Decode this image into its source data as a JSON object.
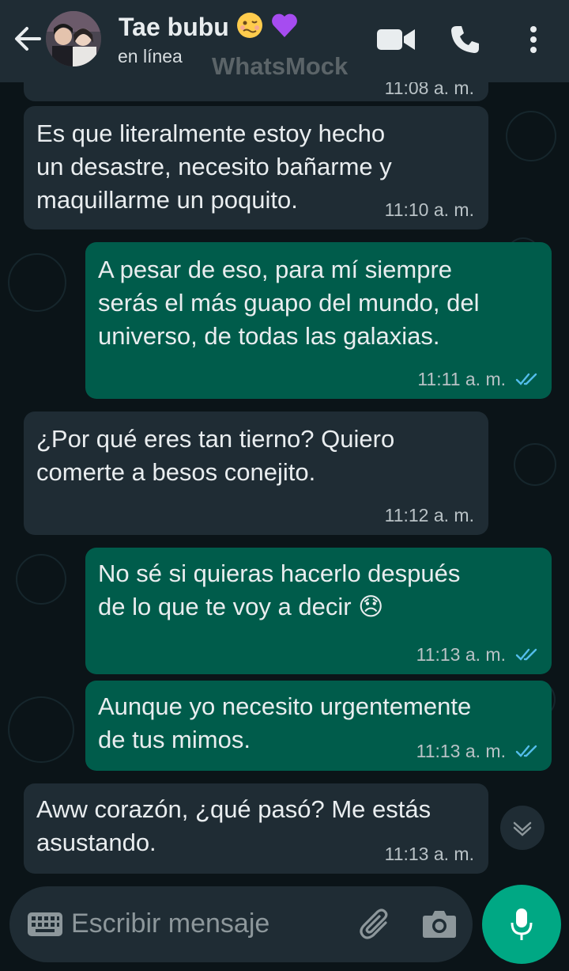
{
  "header": {
    "contact_name": "Tae bubu",
    "status": "en línea",
    "watermark": "WhatsMock",
    "emoji_1": "🥴",
    "emoji_2": "💜"
  },
  "messages": [
    {
      "direction": "in",
      "text": "11:08 a. m.",
      "partial": true
    },
    {
      "direction": "in",
      "text": "Es que literalmente estoy hecho\nun desastre, necesito bañarme y\nmaquillarme un poquito.",
      "time": "11:10 a. m."
    },
    {
      "direction": "out",
      "text": "A pesar de eso, para mí siempre\nserás el más guapo del mundo, del\nuniverso, de todas las galaxias.",
      "time": "11:11 a. m."
    },
    {
      "direction": "in",
      "text": "¿Por qué eres tan tierno? Quiero\ncomerte a besos conejito.",
      "time": "11:12 a. m."
    },
    {
      "direction": "out",
      "text": "No sé si quieras hacerlo después\nde lo que te voy a decir 😞",
      "time": "11:13 a. m."
    },
    {
      "direction": "out",
      "text": "Aunque yo necesito urgentemente\nde tus mimos.",
      "time": "11:13 a. m."
    },
    {
      "direction": "in",
      "text": "Aww corazón, ¿qué pasó? Me estás\nasustando.",
      "time": "11:13 a. m."
    }
  ],
  "composer": {
    "placeholder": "Escribir mensaje"
  },
  "colors": {
    "background": "#0b1418",
    "header": "#1f2c34",
    "incoming_bubble": "#1f2c34",
    "outgoing_bubble": "#005c4b",
    "read_ticks": "#53bdeb",
    "mic_button": "#00a884"
  },
  "icons": [
    "back-arrow-icon",
    "video-call-icon",
    "phone-icon",
    "more-vertical-icon",
    "keyboard-icon",
    "attach-icon",
    "camera-icon",
    "mic-icon",
    "chevron-down-icon"
  ]
}
